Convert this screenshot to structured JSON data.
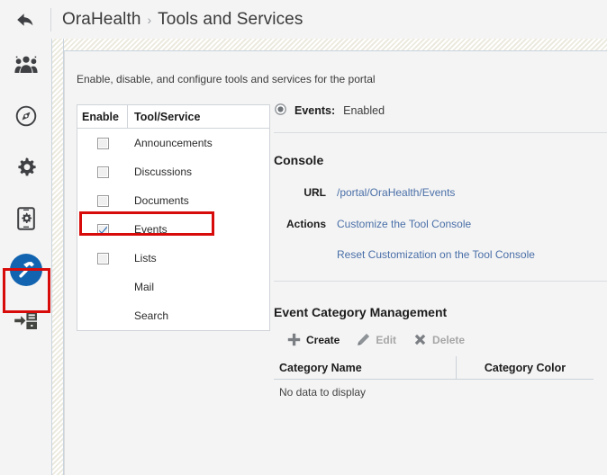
{
  "header": {
    "back_icon": "back-arrow-icon",
    "breadcrumb": {
      "portal": "OraHealth",
      "separator": "›",
      "page": "Tools and Services"
    }
  },
  "sidebar": {
    "items": [
      {
        "icon": "people-group-icon",
        "name": "members",
        "active": false
      },
      {
        "icon": "compass-icon",
        "name": "navigation",
        "active": false
      },
      {
        "icon": "gear-icon",
        "name": "settings",
        "active": false
      },
      {
        "icon": "mobile-device-gear-icon",
        "name": "device-settings",
        "active": false
      },
      {
        "icon": "hammer-tools-icon",
        "name": "tools-and-services",
        "active": true
      },
      {
        "icon": "import-to-server-icon",
        "name": "deploy",
        "active": false
      }
    ],
    "highlight_color": "#d80b0b",
    "active_color": "#1364b0"
  },
  "content": {
    "intro": "Enable, disable, and configure tools and services for the portal",
    "tools_table": {
      "columns": [
        "Enable",
        "Tool/Service"
      ],
      "rows": [
        {
          "name": "Announcements",
          "has_checkbox": true,
          "checked": false,
          "highlighted": false
        },
        {
          "name": "Discussions",
          "has_checkbox": true,
          "checked": false,
          "highlighted": false
        },
        {
          "name": "Documents",
          "has_checkbox": true,
          "checked": false,
          "highlighted": false
        },
        {
          "name": "Events",
          "has_checkbox": true,
          "checked": true,
          "highlighted": true
        },
        {
          "name": "Lists",
          "has_checkbox": true,
          "checked": false,
          "highlighted": false
        },
        {
          "name": "Mail",
          "has_checkbox": false,
          "checked": false,
          "highlighted": false
        },
        {
          "name": "Search",
          "has_checkbox": false,
          "checked": false,
          "highlighted": false
        }
      ]
    },
    "detail": {
      "status_label": "Events:",
      "status_value": "Enabled",
      "status_icon": "radio-selected-icon",
      "console_title": "Console",
      "url_label": "URL",
      "url_value": "/portal/OraHealth/Events",
      "actions_label": "Actions",
      "action_links": [
        "Customize the Tool Console",
        "Reset Customization on the Tool Console"
      ],
      "link_color": "#4a6fa8"
    },
    "category": {
      "title": "Event Category Management",
      "toolbar": [
        {
          "label": "Create",
          "icon": "plus-icon",
          "enabled": true
        },
        {
          "label": "Edit",
          "icon": "pencil-icon",
          "enabled": false
        },
        {
          "label": "Delete",
          "icon": "x-close-icon",
          "enabled": false
        }
      ],
      "columns": [
        "Category Name",
        "Category Color"
      ],
      "empty_message": "No data to display"
    }
  }
}
